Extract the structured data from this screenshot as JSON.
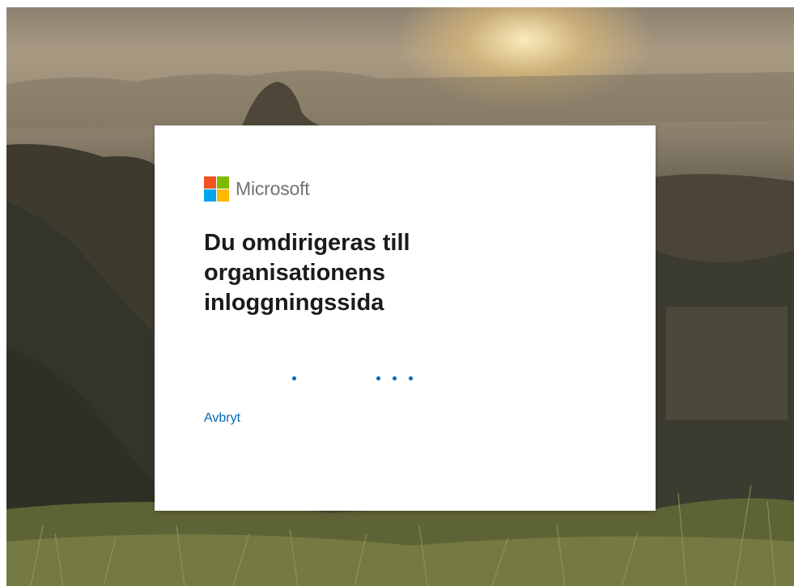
{
  "brand": {
    "name": "Microsoft",
    "logo_colors": [
      "#f25022",
      "#7fba00",
      "#00a4ef",
      "#ffb900"
    ]
  },
  "dialog": {
    "title": "Du omdirigeras till organisationens inloggningssida",
    "progress_indicator": "loading-dots",
    "cancel_label": "Avbryt",
    "accent_color": "#0067b8"
  }
}
